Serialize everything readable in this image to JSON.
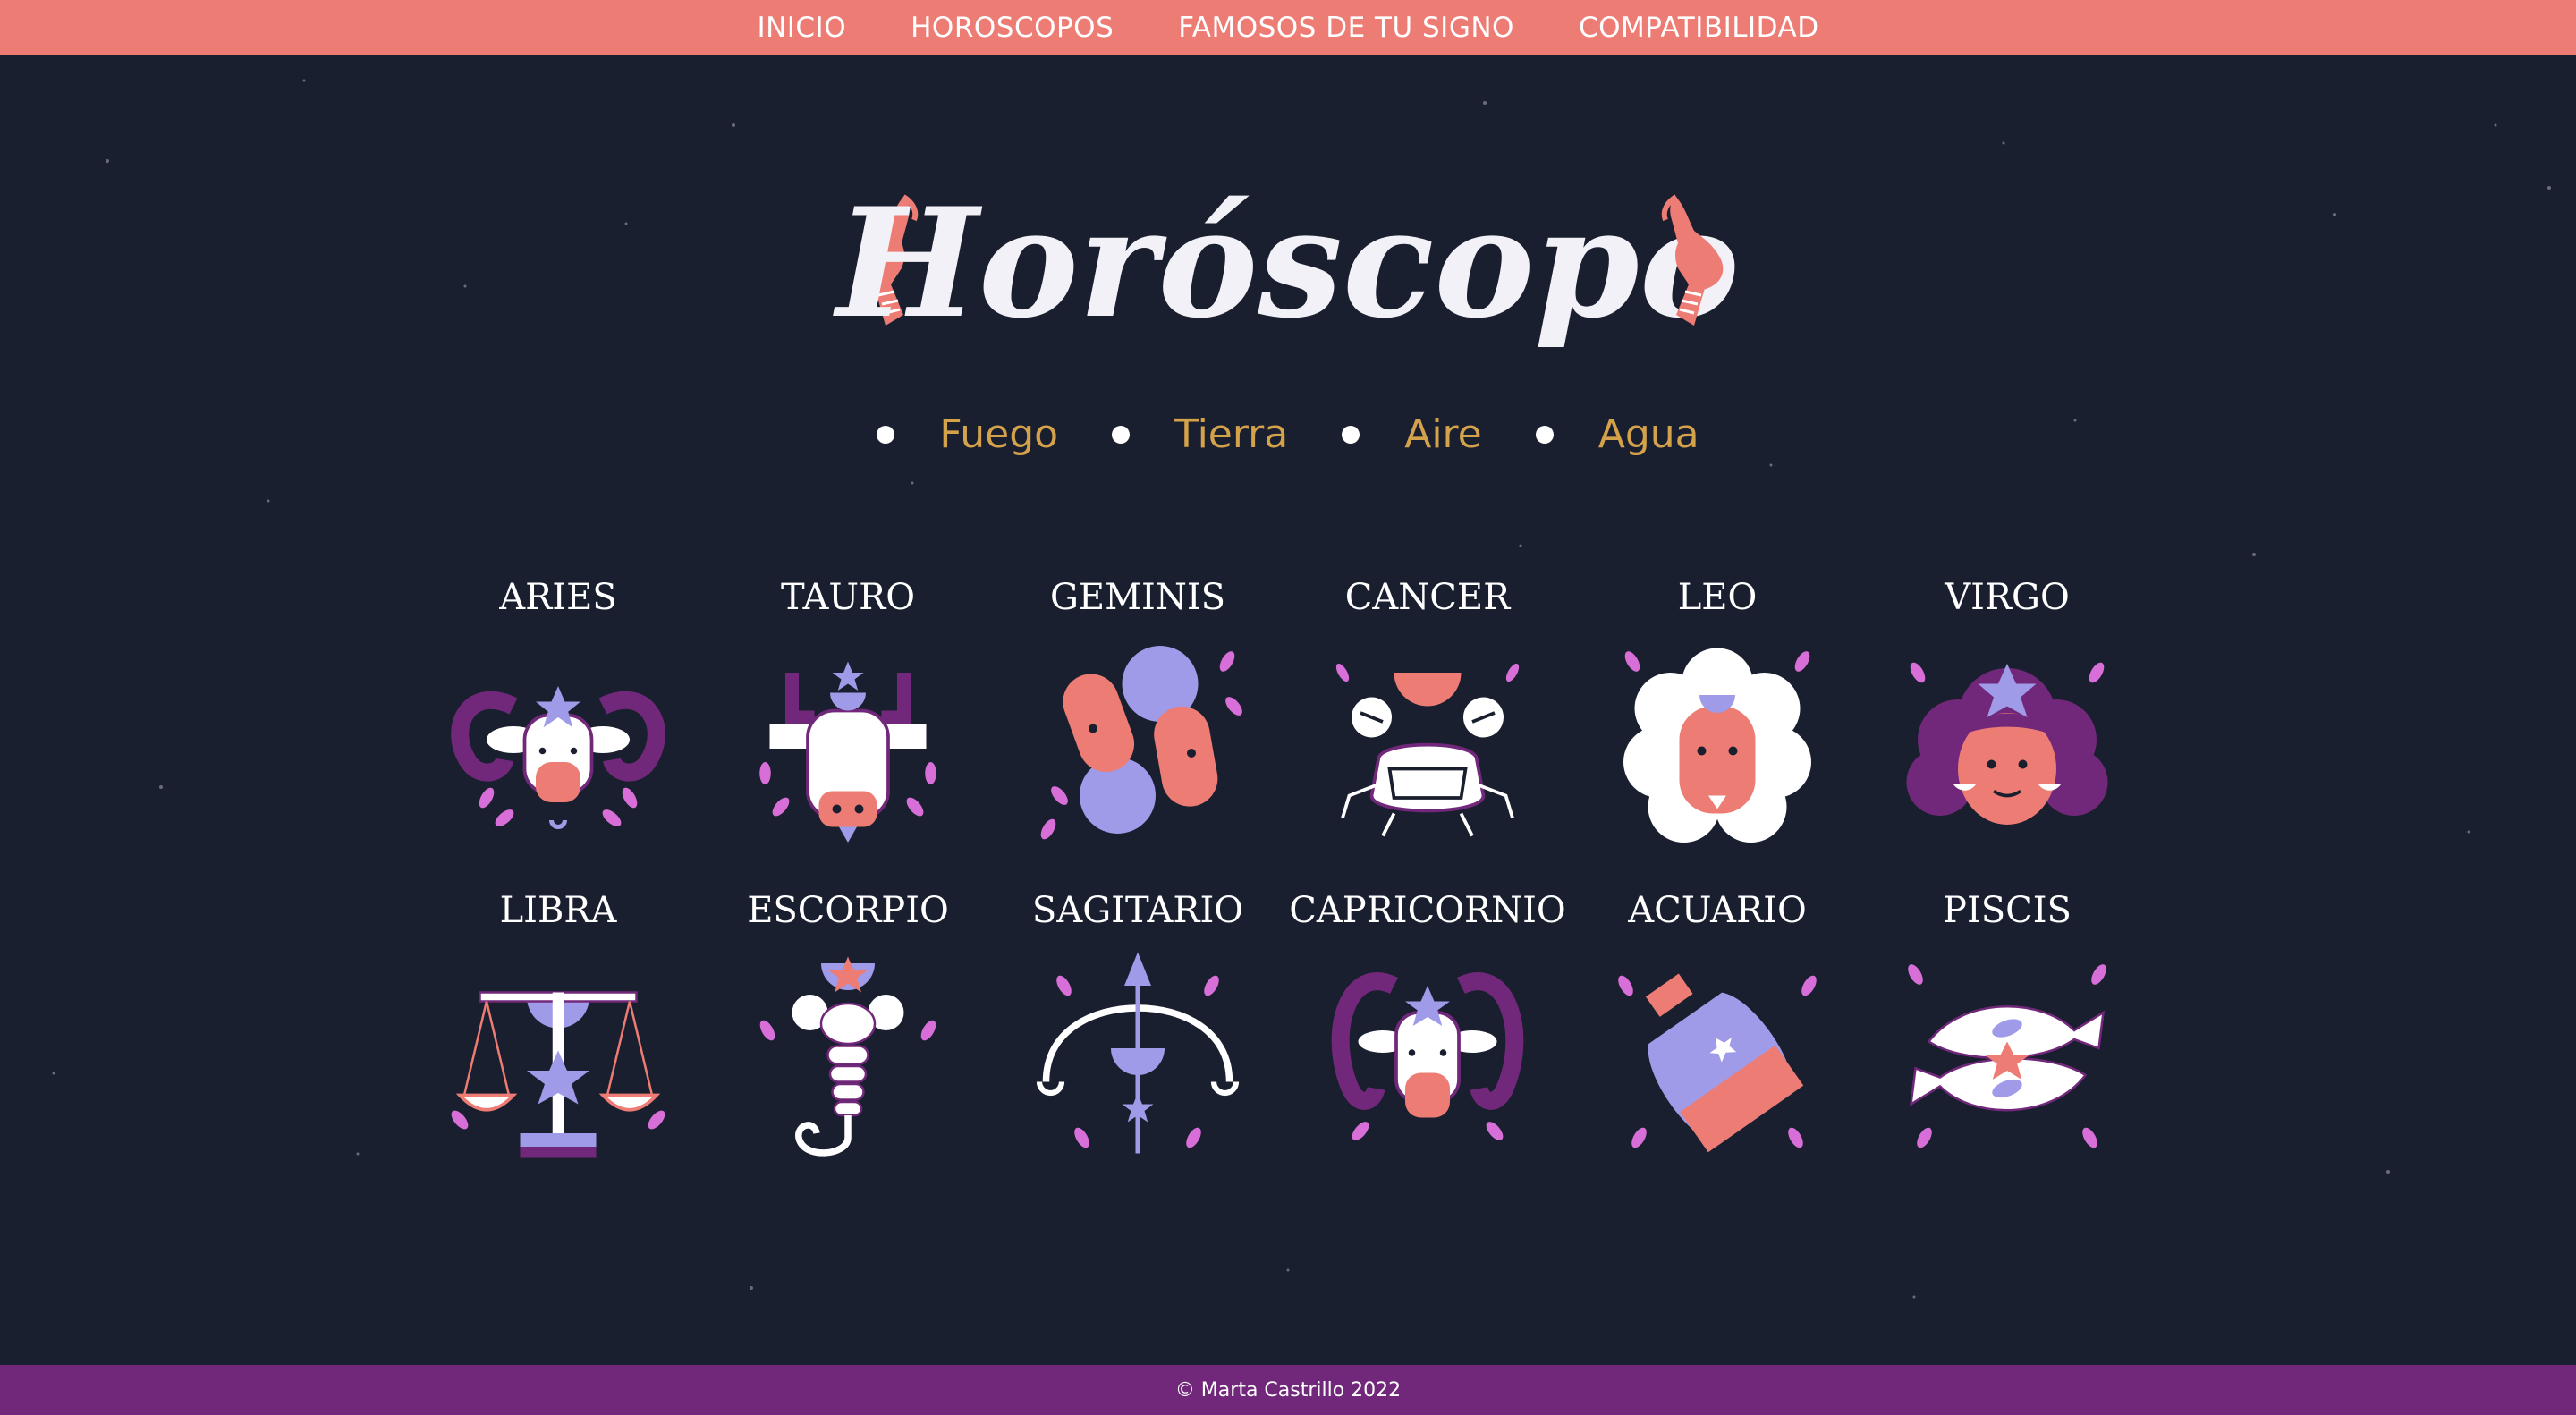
{
  "nav": {
    "items": [
      "INICIO",
      "HOROSCOPOS",
      "FAMOSOS DE TU SIGNO",
      "COMPATIBILIDAD"
    ]
  },
  "hero": {
    "title": "Horóscopo",
    "hand_icon": "hand-icon"
  },
  "elements": [
    "Fuego",
    "Tierra",
    "Aire",
    "Agua"
  ],
  "signs": [
    {
      "name": "ARIES",
      "icon": "aries-icon"
    },
    {
      "name": "TAURO",
      "icon": "tauro-icon"
    },
    {
      "name": "GEMINIS",
      "icon": "geminis-icon"
    },
    {
      "name": "CANCER",
      "icon": "cancer-icon"
    },
    {
      "name": "LEO",
      "icon": "leo-icon"
    },
    {
      "name": "VIRGO",
      "icon": "virgo-icon"
    },
    {
      "name": "LIBRA",
      "icon": "libra-icon"
    },
    {
      "name": "ESCORPIO",
      "icon": "escorpio-icon"
    },
    {
      "name": "SAGITARIO",
      "icon": "sagitario-icon"
    },
    {
      "name": "CAPRICORNIO",
      "icon": "capricornio-icon"
    },
    {
      "name": "ACUARIO",
      "icon": "acuario-icon"
    },
    {
      "name": "PISCIS",
      "icon": "piscis-icon"
    }
  ],
  "footer": {
    "text": "© Marta Castrillo 2022"
  },
  "colors": {
    "background": "#1a1f2f",
    "nav": "#ec7c74",
    "footer": "#72287a",
    "element_label": "#d4a24a",
    "coral": "#ec7c74",
    "lavender": "#a09be8",
    "purple": "#72287a",
    "leaf": "#d86fd8"
  }
}
